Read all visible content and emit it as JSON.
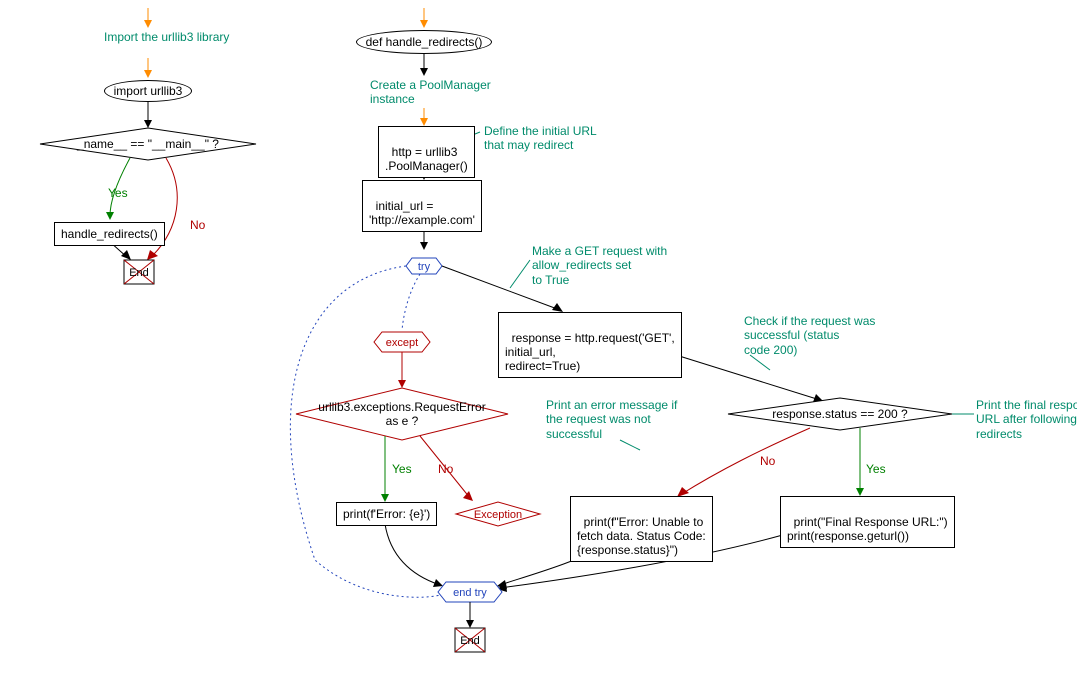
{
  "left": {
    "comment_import": "Import the urllib3 library",
    "import_stmt": "import urllib3",
    "main_check": "_name__ == \"__main__\" ?",
    "yes": "Yes",
    "no": "No",
    "call": "handle_redirects()",
    "end": "End"
  },
  "right": {
    "fn_def": "def handle_redirects()",
    "comment_pool": "Create a PoolManager\ninstance",
    "pool_code": "http = urllib3\n.PoolManager()",
    "comment_url": "Define the initial URL\nthat may redirect",
    "url_code": "initial_url =\n'http://example.com'",
    "try_label": "try",
    "comment_get": "Make a GET request with\nallow_redirects set\nto True",
    "request_code": "response = http.request('GET',\ninitial_url,\nredirect=True)",
    "except_label": "except",
    "except_cond": "urllib3.exceptions.RequestError\nas e ?",
    "comment_check": "Check if the request was\nsuccessful (status\ncode 200)",
    "status_check": "response.status == 200 ?",
    "comment_final": "Print the final response\nURL after following\nredirects",
    "yes": "Yes",
    "no": "No",
    "print_err": "print(f'Error: {e}')",
    "exception_label": "Exception",
    "comment_unable": "Print an error message if\nthe request was not\nsuccessful",
    "print_unable": "print(f\"Error: Unable to\nfetch data. Status Code:\n{response.status}\")",
    "print_final": "print(\"Final Response URL:\")\nprint(response.geturl())",
    "end_try": "end try",
    "end": "End"
  }
}
